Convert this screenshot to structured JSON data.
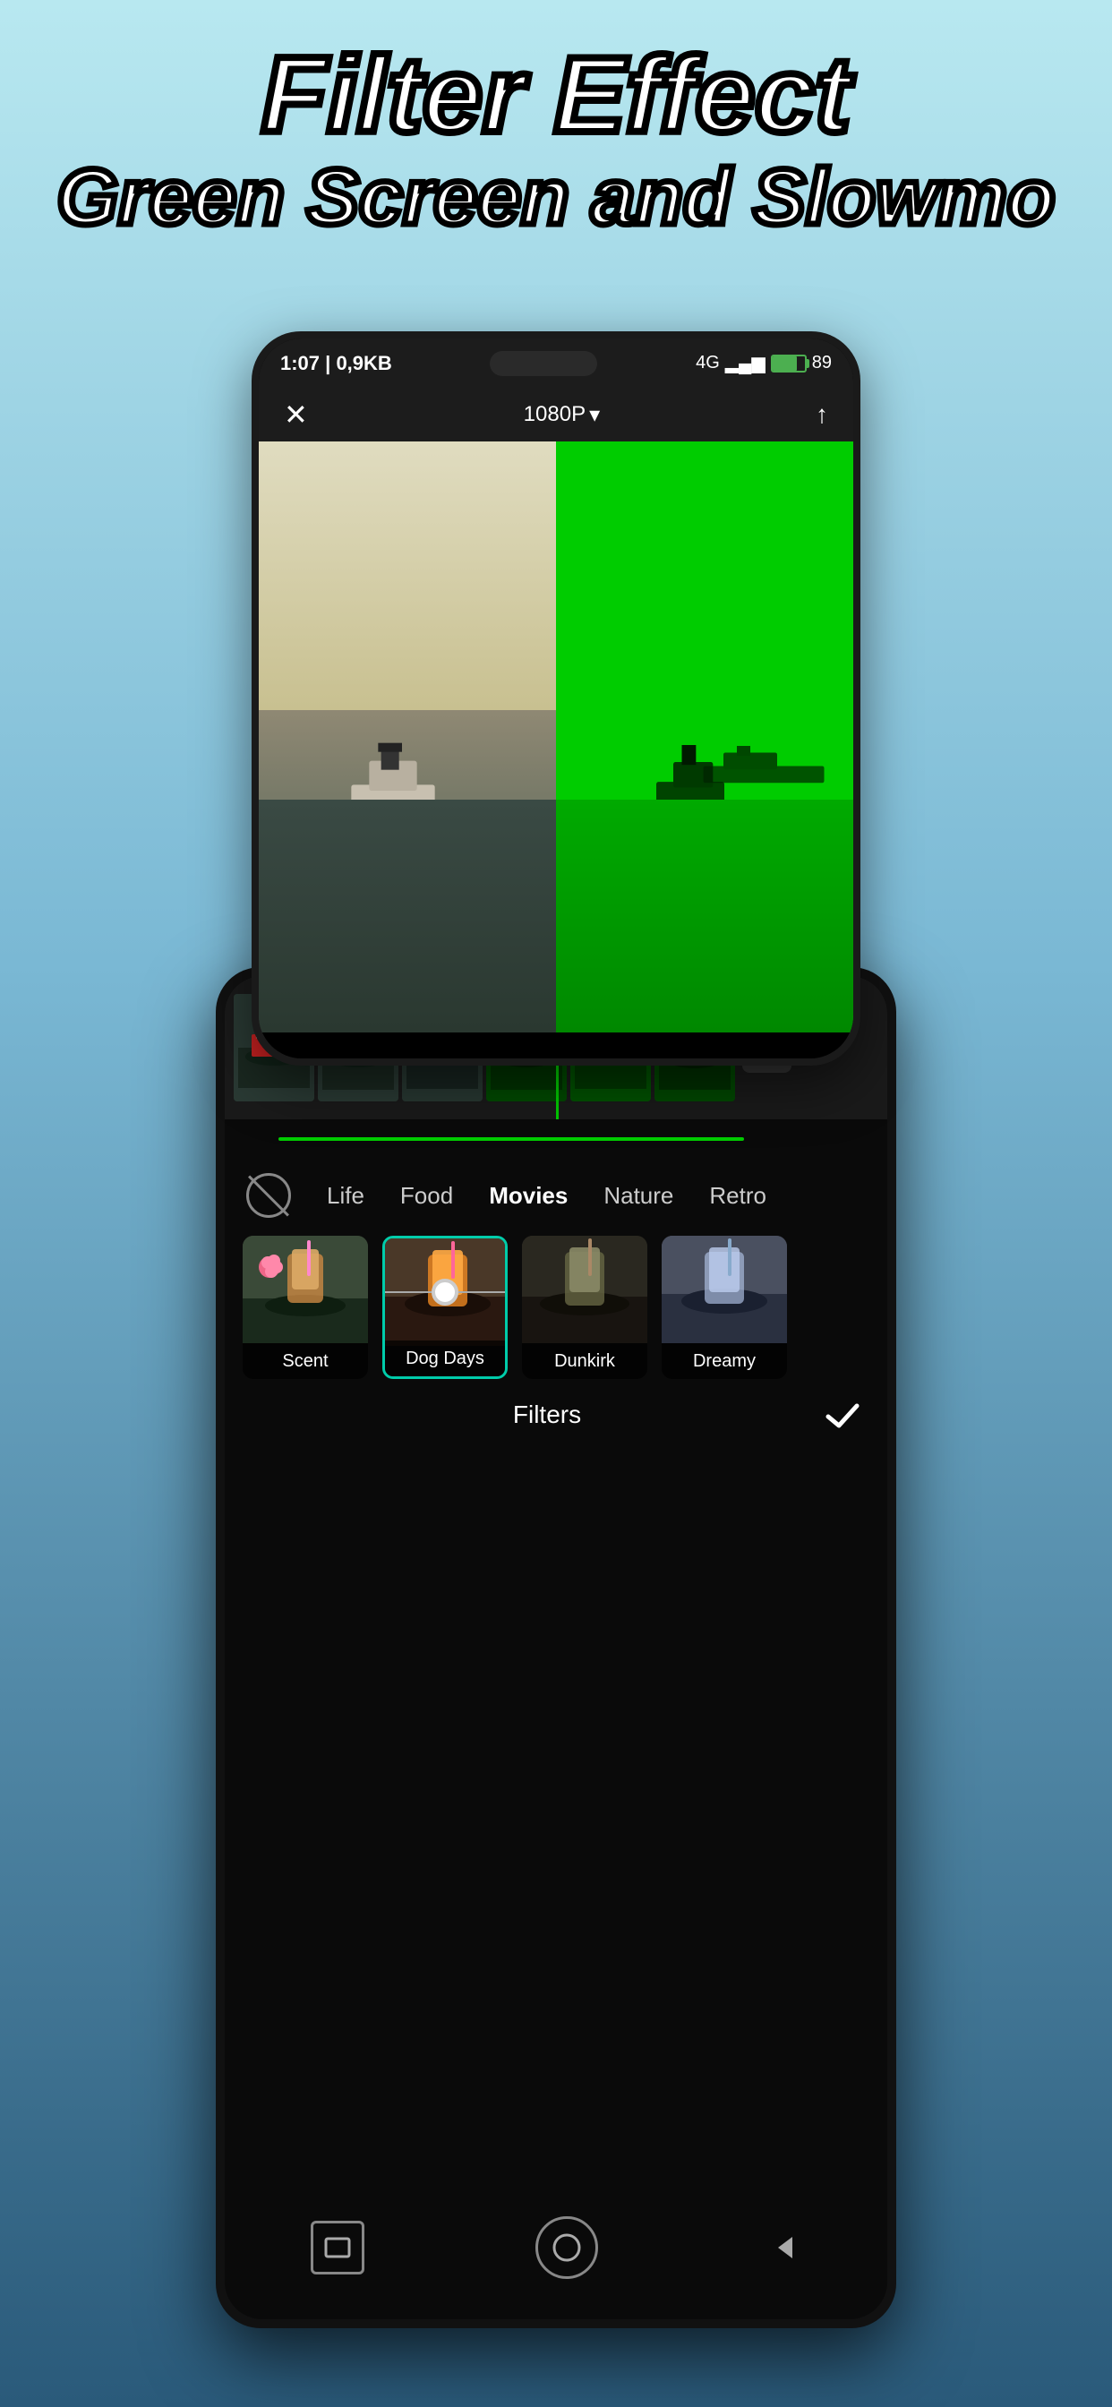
{
  "header": {
    "line1": "Filter Effect",
    "line2": "Green Screen and Slowmo"
  },
  "phone_top": {
    "status": {
      "time": "1:07",
      "data": "0,9KB",
      "signal": "4G",
      "battery": "89"
    },
    "toolbar": {
      "resolution": "1080P",
      "close_label": "✕",
      "export_label": "↑"
    }
  },
  "phone_bottom": {
    "timeline": {
      "add_button": "+"
    },
    "filters": {
      "no_filter_label": "",
      "categories": [
        "Life",
        "Food",
        "Movies",
        "Nature",
        "Retro"
      ],
      "active_category": "Movies",
      "items": [
        {
          "name": "Scent",
          "active": false
        },
        {
          "name": "Dog Days",
          "active": false
        },
        {
          "name": "Dunkirk",
          "active": false
        },
        {
          "name": "Dreamy",
          "active": true
        }
      ],
      "footer_label": "Filters",
      "check_icon": "✓"
    },
    "nav": {
      "square_label": "□",
      "circle_label": "○",
      "back_label": "◁"
    }
  }
}
